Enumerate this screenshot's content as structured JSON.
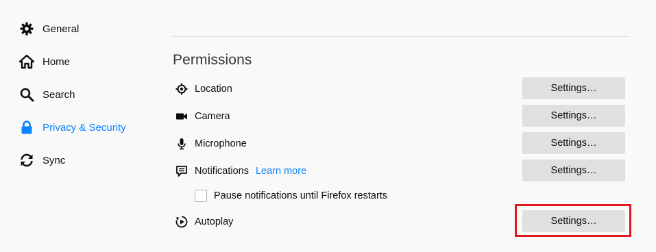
{
  "sidebar": {
    "items": [
      {
        "label": "General",
        "icon": "gear-icon",
        "selected": false
      },
      {
        "label": "Home",
        "icon": "home-icon",
        "selected": false
      },
      {
        "label": "Search",
        "icon": "search-icon",
        "selected": false
      },
      {
        "label": "Privacy & Security",
        "icon": "lock-icon",
        "selected": true
      },
      {
        "label": "Sync",
        "icon": "sync-icon",
        "selected": false
      }
    ]
  },
  "permissions": {
    "title": "Permissions",
    "rows": [
      {
        "label": "Location",
        "icon": "location-icon",
        "button": "Settings…"
      },
      {
        "label": "Camera",
        "icon": "camera-icon",
        "button": "Settings…"
      },
      {
        "label": "Microphone",
        "icon": "microphone-icon",
        "button": "Settings…"
      },
      {
        "label": "Notifications",
        "icon": "notifications-icon",
        "link": "Learn more",
        "button": "Settings…"
      },
      {
        "label": "Autoplay",
        "icon": "autoplay-icon",
        "button": "Settings…"
      }
    ],
    "pause_checkbox": {
      "label": "Pause notifications until Firefox restarts",
      "checked": false
    }
  },
  "colors": {
    "accent": "#0a84ff",
    "highlight": "#e0181e",
    "button_bg": "#e0e0e2",
    "background": "#f9f9fa"
  }
}
